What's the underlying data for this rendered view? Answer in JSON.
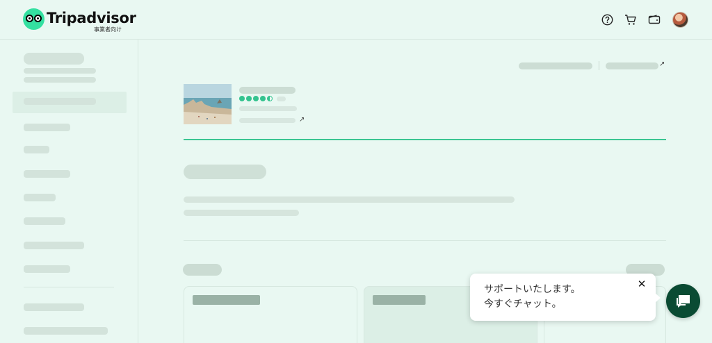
{
  "header": {
    "brand": "Tripadvisor",
    "brand_sub": "事業者向け",
    "icons": [
      "help-icon",
      "cart-icon",
      "wallet-icon",
      "avatar"
    ]
  },
  "rating": {
    "bubbles": 4.5,
    "max": 5,
    "color": "#34c38f"
  },
  "chat": {
    "line1": "サポートいたします。",
    "line2": "今すぐチャット。",
    "close_glyph": "✕",
    "button_color": "#0a4b33"
  },
  "colors": {
    "background": "#e9f8f2",
    "accent": "#3bc593",
    "skeleton": "#d3e3db"
  }
}
